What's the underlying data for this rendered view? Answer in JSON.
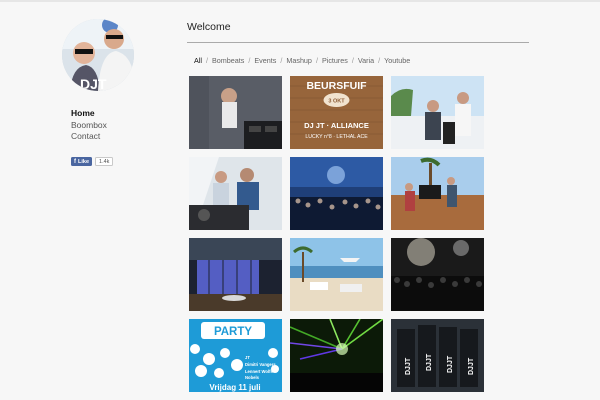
{
  "page": {
    "title": "Welcome"
  },
  "sidebar": {
    "nav": [
      {
        "label": "Home",
        "active": true
      },
      {
        "label": "Boombox",
        "active": false
      },
      {
        "label": "Contact",
        "active": false
      }
    ],
    "facebook": {
      "like_label": "Like",
      "count": "1.4k"
    }
  },
  "filters": [
    "All",
    "Bombeats",
    "Events",
    "Mashup",
    "Pictures",
    "Varia",
    "Youtube"
  ],
  "filter_separator": "/",
  "gallery": {
    "tile_2": {
      "heading": "BEURSFUIF",
      "date": "3 OKT",
      "line1": "DJ JT · ALLIANCE",
      "line2": "LUCKY n°8 · LETHAL ACE"
    },
    "tile_10": {
      "heading": "PARTY",
      "footer": "Vrijdag 11 juli"
    },
    "tile_12": {
      "label": "DJJT"
    }
  },
  "colors": {
    "accent_fb": "#4a66a0",
    "poster_brown": "#8b5a33",
    "party_blue": "#1e9bd7"
  }
}
